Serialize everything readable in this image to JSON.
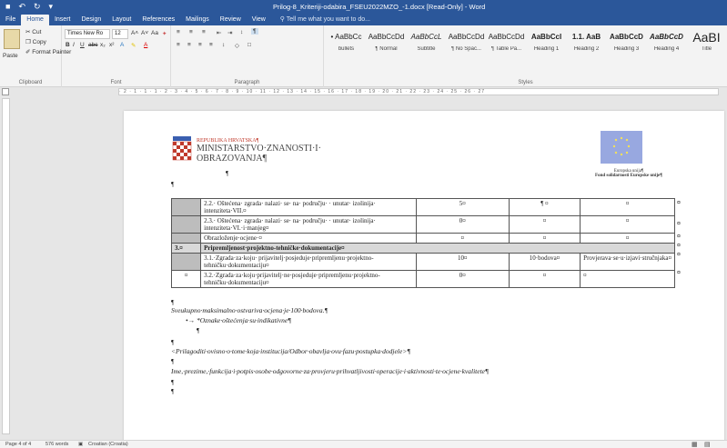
{
  "window": {
    "title": "Prilog-8_Kriteriji-odabira_FSEU2022MZO_-1.docx [Read-Only] - Word",
    "qat": [
      "■",
      "↶",
      "↻",
      "▾"
    ]
  },
  "tabs": [
    "File",
    "Home",
    "Insert",
    "Design",
    "Layout",
    "References",
    "Mailings",
    "Review",
    "View"
  ],
  "active_tab": "Home",
  "tell_me": "Tell me what you want to do...",
  "clipboard": {
    "paste": "Paste",
    "cut": "Cut",
    "copy": "Copy",
    "format_painter": "Format Painter",
    "label": "Clipboard"
  },
  "font": {
    "name": "Times New Ro",
    "size": "12",
    "label": "Font",
    "grow": "A˄",
    "shrink": "A˅",
    "case": "Aa",
    "clear": "✦",
    "bold": "B",
    "italic": "I",
    "underline": "U",
    "strike": "abc",
    "sub": "x₂",
    "sup": "x²",
    "effects": "A",
    "highlight": "✎",
    "color": "A"
  },
  "paragraph": {
    "label": "Paragraph",
    "bullets": "≡",
    "numbering": "≡",
    "multilevel": "≡",
    "decrease": "⇤",
    "increase": "⇥",
    "sort": "↕",
    "show": "¶",
    "align_left": "≡",
    "center": "≡",
    "align_right": "≡",
    "justify": "≡",
    "spacing": "↕",
    "shading": "◇",
    "borders": "□"
  },
  "styles": {
    "label": "Styles",
    "items": [
      {
        "preview": "• AaBbCc",
        "name": "bullets"
      },
      {
        "preview": "AaBbCcDd",
        "name": "¶ Normal"
      },
      {
        "preview": "AaBbCcL",
        "name": "Subtitle"
      },
      {
        "preview": "AaBbCcDd",
        "name": "¶ No Spac..."
      },
      {
        "preview": "AaBbCcDd",
        "name": "¶ Table Pa..."
      },
      {
        "preview": "AaBbCcI",
        "name": "Heading 1"
      },
      {
        "preview": "1.1. AaB",
        "name": "Heading 2"
      },
      {
        "preview": "AaBbCcD",
        "name": "Heading 3"
      },
      {
        "preview": "AaBbCcD",
        "name": "Heading 4"
      },
      {
        "preview": "AaBI",
        "name": "Title"
      }
    ]
  },
  "ruler_text": "· 2 · 1 · 1 · 1 · 2 · 3 · 4 · 5 · 6 · 7 · 8 · 9 · 10 · 11 · 12 · 13 · 14 · 15 · 16 · 17 · 18 · 19 · 20 · 21 · 22 · 23 · 24 · 25 · 26 · 27",
  "header": {
    "ministry_small": "REPUBLIKA HRVATSKA¶",
    "ministry_line1": "MINISTARSTVO·ZNANOSTI·I·",
    "ministry_line2": "OBRAZOVANJA¶",
    "eu_cap1": "Europska unija¶",
    "eu_cap2": "Fond solidarnosti Europske unije¶"
  },
  "table": {
    "rows": [
      {
        "num": "",
        "text": "2.2.· Oštećena· zgrada· nalazi· se· na· području· · unutar· izolinija· intenziteta·VII.¤",
        "c1": "5¤",
        "c2": "¶ ¤",
        "c3": "¤"
      },
      {
        "num": "",
        "text": "2.3.· Oštećena· zgrada· nalazi· se· na· području· · unutar· izolinija· intenziteta·VI.·i·manjeg¤",
        "c1": "0¤",
        "c2": "¤",
        "c3": "¤"
      },
      {
        "num": "",
        "text": "Obrazloženje·ocjene·¤",
        "c1": "¤",
        "c2": "¤",
        "c3": "¤"
      },
      {
        "num": "3.¤",
        "text": "Pripremljenost·projektno-tehničke·dokumentacije¤",
        "c1": "",
        "c2": "",
        "c3": "",
        "section": true
      },
      {
        "num": "",
        "text": "3.1.·Zgrada·za·koju· prijavitelj·posjeduje·pripremljenu·projektno-tehničku·dokumentaciju¤",
        "c1": "10¤",
        "c2": "10·bodova¤",
        "c3": "Provjerava·se·u·izjavi·stručnjaka¤"
      },
      {
        "num": "¤",
        "text": "3.2.·Zgrada·za·koju·prijavitelj·ne·posjeduje·pripremljenu·projektno-tehničku·dokumentaciju¤",
        "c1": "0¤",
        "c2": "¤",
        "c3": "¤"
      }
    ]
  },
  "body": {
    "pil": "¶",
    "max_score": "Sveukupno·maksimalno·ostvariva·ocjena·je·100·bodova.¶",
    "bullet": "•→ *Oznake·oštećenja·su·indikativne¶",
    "adjust": "<Prilagoditi·ovisno·o·tome·koja·institucija/Odbor·obavlja·ovu·fazu·postupka·dodjele>¶",
    "name_line": "Ime,·prezime,·funkcija·i·potpis·osobe·odgovorne·za·provjeru·prihvatljivosti·operacije·i·aktivnosti·te·ocjene·kvalitete¶",
    "end_mark": "¤"
  },
  "status": {
    "page": "Page 4 of 4",
    "words": "576 words",
    "lang": "Croatian (Croatia)"
  },
  "colors": {
    "accent": "#2b579a",
    "ministry_red": "#c0392b",
    "eu_blue": "#98a8e0"
  }
}
